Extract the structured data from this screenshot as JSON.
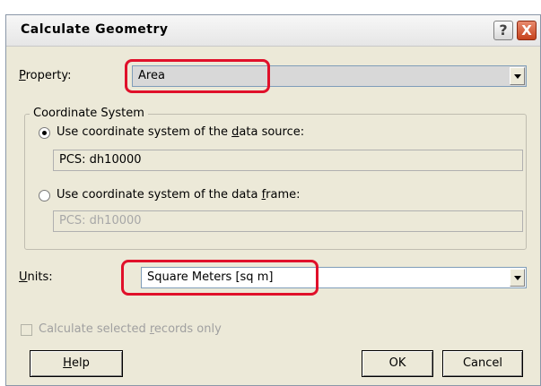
{
  "dialog": {
    "title": "Calculate Geometry",
    "help_icon_text": "?",
    "close_icon_text": "X"
  },
  "property": {
    "label_underlined": "P",
    "label_rest": "roperty:",
    "value": "Area"
  },
  "coordinate_system": {
    "legend": "Coordinate System",
    "option_source": {
      "label_pre": "Use coordinate system of the ",
      "label_underlined": "d",
      "label_post": "ata source:",
      "selected": true,
      "value": "PCS: dh10000"
    },
    "option_frame": {
      "label_pre": "Use coordinate system of the data ",
      "label_underlined": "f",
      "label_post": "rame:",
      "selected": false,
      "value": "PCS: dh10000"
    }
  },
  "units": {
    "label_underlined": "U",
    "label_rest": "nits:",
    "value": "Square Meters [sq m]"
  },
  "selected_only": {
    "label_pre": "Calculate selected ",
    "label_underlined": "r",
    "label_post": "ecords only",
    "checked": false
  },
  "buttons": {
    "help_underlined": "H",
    "help_rest": "elp",
    "ok": "OK",
    "cancel": "Cancel"
  },
  "colors": {
    "dialog_bg": "#ece9d8",
    "highlight": "#e0102a",
    "close_button": "#c6421c"
  }
}
